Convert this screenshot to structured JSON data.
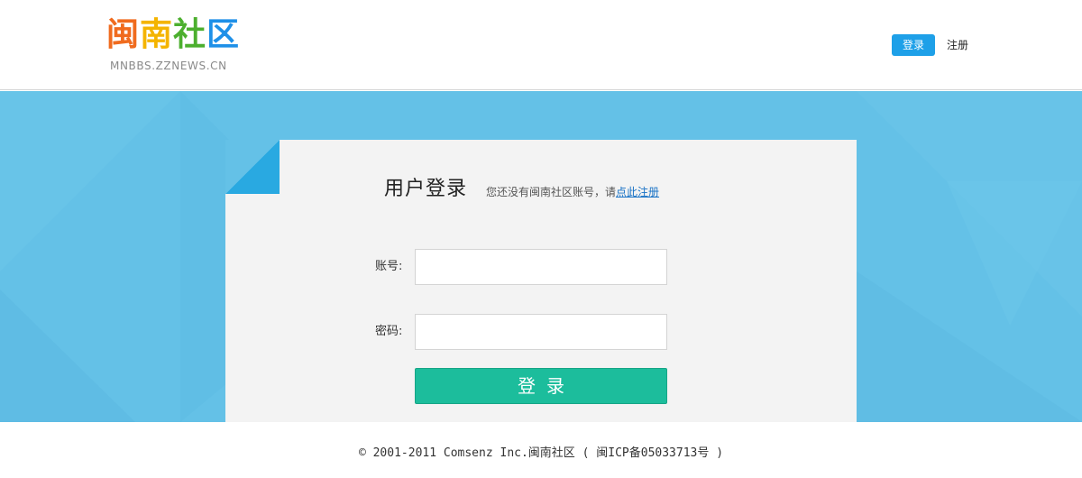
{
  "header": {
    "logo_chars": [
      {
        "char": "闽",
        "color": "#f06b1e"
      },
      {
        "char": "南",
        "color": "#f4b400"
      },
      {
        "char": "社",
        "color": "#4caf2e"
      },
      {
        "char": "区",
        "color": "#1e90e8"
      }
    ],
    "logo_sub": "MNBBS.ZZNEWS.CN",
    "nav_login": "登录",
    "nav_register": "注册"
  },
  "form": {
    "title": "用户登录",
    "subtitle_prefix": "您还没有闽南社区账号，请",
    "subtitle_link": "点此注册",
    "account_label": "账号:",
    "password_label": "密码:",
    "account_value": "",
    "password_value": "",
    "submit_label": "登录"
  },
  "footer": {
    "text": "© 2001-2011 Comsenz Inc.闽南社区 ( 闽ICP备05033713号 )"
  },
  "colors": {
    "banner": "#64c1e7",
    "accent": "#1ea0e8",
    "submit": "#1cbd9c",
    "card": "#f3f3f3"
  }
}
